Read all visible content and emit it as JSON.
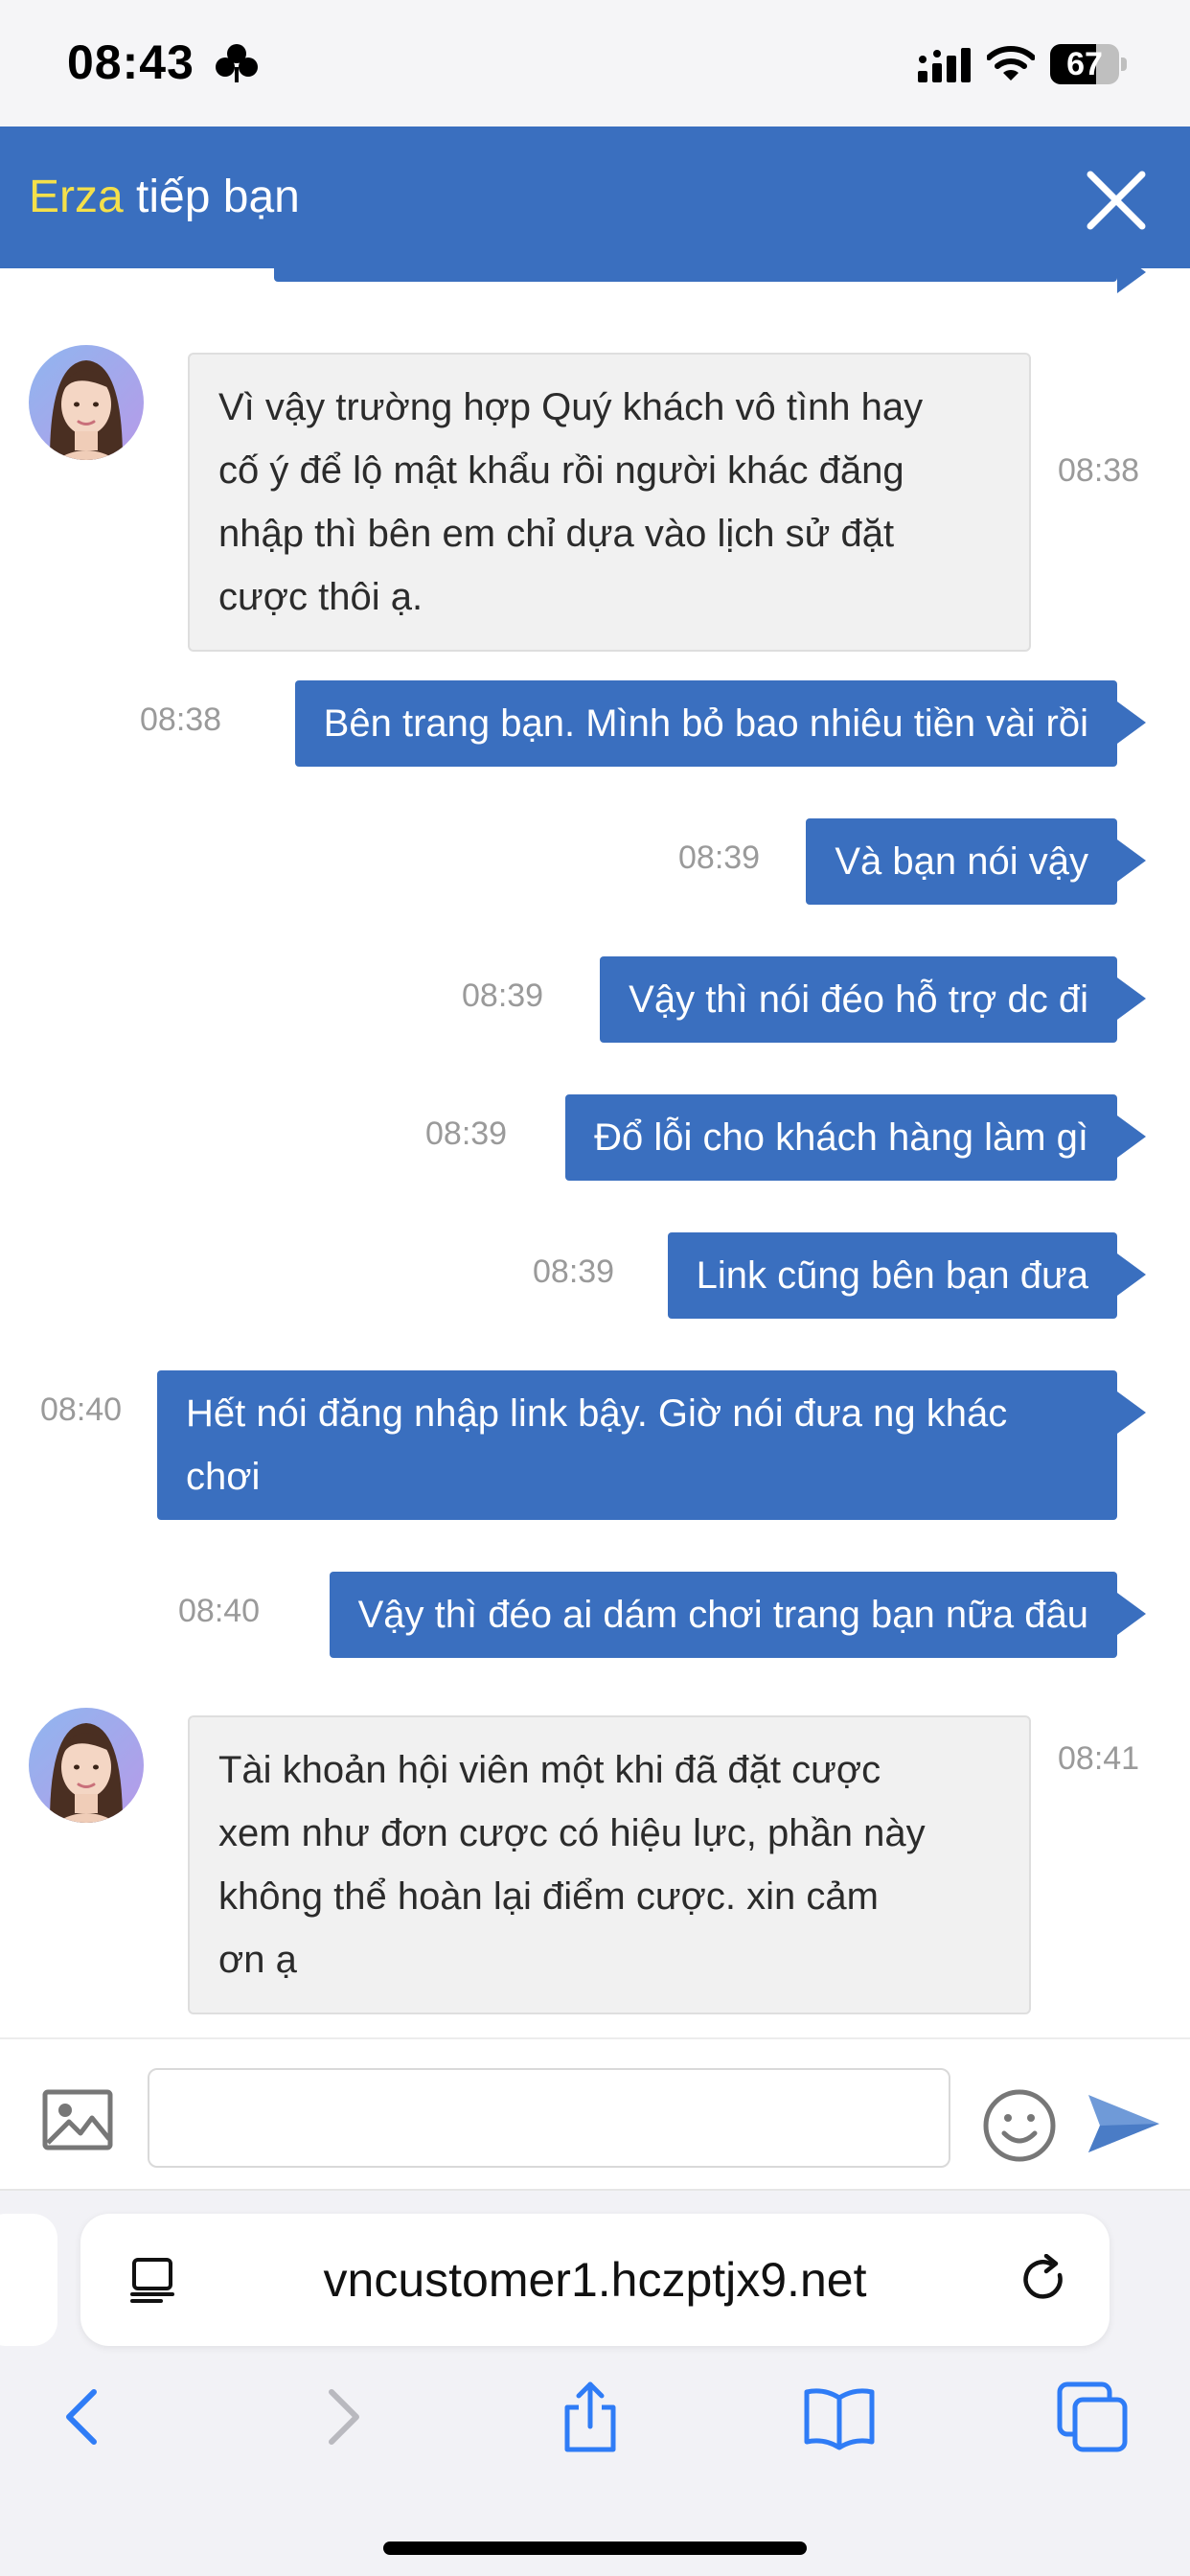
{
  "status_bar": {
    "time": "08:43",
    "battery": 67,
    "focus_icon": "clover-focus-icon",
    "signal_icon": "cellular-signal-icon",
    "wifi_icon": "wifi-icon"
  },
  "header": {
    "agent_name": "Erza",
    "title_rest": " tiếp bạn",
    "close_icon": "close-icon",
    "accent_color": "#3a6fbf",
    "agent_color": "#f4e04a"
  },
  "messages": [
    {
      "from": "agent",
      "time": "08:38",
      "lines": [
        "Vì vậy trường hợp Quý khách vô tình hay",
        "cố ý để lộ mật khẩu rồi người khác đăng",
        "nhập thì bên em chỉ dựa vào lịch sử đặt",
        "cược thôi ạ."
      ]
    },
    {
      "from": "user",
      "time": "08:38",
      "lines": [
        "Bên trang bạn. Mình bỏ bao nhiêu tiền vài rồi"
      ]
    },
    {
      "from": "user",
      "time": "08:39",
      "lines": [
        "Và bạn nói vậy"
      ]
    },
    {
      "from": "user",
      "time": "08:39",
      "lines": [
        "Vậy thì nói đéo hỗ trợ dc đi"
      ]
    },
    {
      "from": "user",
      "time": "08:39",
      "lines": [
        "Đổ lỗi cho khách hàng làm gì"
      ]
    },
    {
      "from": "user",
      "time": "08:39",
      "lines": [
        "Link cũng bên bạn đưa"
      ]
    },
    {
      "from": "user",
      "time": "08:40",
      "lines": [
        "Hết nói đăng nhập link bậy. Giờ nói đưa ng khác",
        "chơi"
      ]
    },
    {
      "from": "user",
      "time": "08:40",
      "lines": [
        "Vậy thì đéo ai dám chơi trang bạn nữa đâu"
      ]
    },
    {
      "from": "agent",
      "time": "08:41",
      "lines": [
        "Tài khoản hội viên một khi đã đặt cược",
        "xem như đơn cược có hiệu lực, phần này",
        "không thể hoàn lại điểm cược. xin cảm",
        "ơn ạ"
      ]
    }
  ],
  "composer": {
    "input_value": "",
    "image_icon": "image-upload-icon",
    "emoji_icon": "emoji-icon",
    "send_icon": "send-icon"
  },
  "browser": {
    "url": "vncustomer1.hczptjx9.net",
    "reader_icon": "reader-mode-icon",
    "reload_icon": "reload-icon",
    "toolbar_icons": [
      "back-icon",
      "forward-icon",
      "share-icon",
      "bookmarks-icon",
      "tabs-icon"
    ]
  }
}
